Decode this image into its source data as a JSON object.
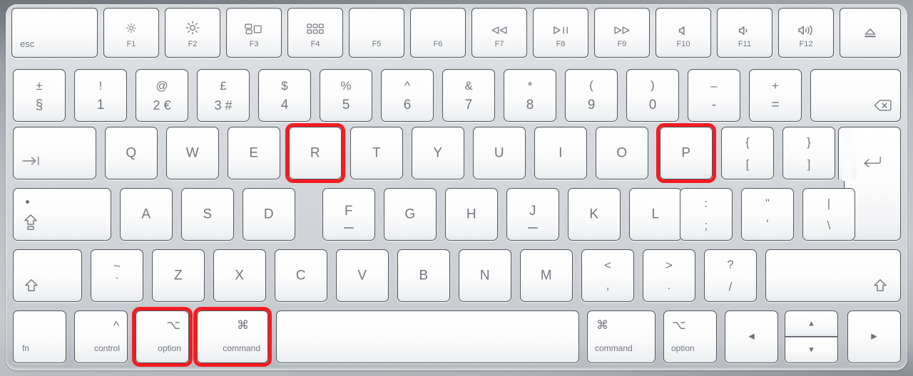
{
  "device": {
    "name": "apple-magic-keyboard",
    "layout": "British ISO",
    "body_color": "#d4d8dc",
    "highlight_color": "#f31c20"
  },
  "highlighted_keys": [
    "R",
    "P",
    "option",
    "command"
  ],
  "rows": {
    "function_row": [
      {
        "id": "esc",
        "label": "esc",
        "icon": null
      },
      {
        "id": "f1",
        "label": "F1",
        "icon": "brightness-down-icon"
      },
      {
        "id": "f2",
        "label": "F2",
        "icon": "brightness-up-icon"
      },
      {
        "id": "f3",
        "label": "F3",
        "icon": "mission-control-icon"
      },
      {
        "id": "f4",
        "label": "F4",
        "icon": "launchpad-icon"
      },
      {
        "id": "f5",
        "label": "F5",
        "icon": null
      },
      {
        "id": "f6",
        "label": "F6",
        "icon": null
      },
      {
        "id": "f7",
        "label": "F7",
        "icon": "rewind-icon"
      },
      {
        "id": "f8",
        "label": "F8",
        "icon": "play-pause-icon"
      },
      {
        "id": "f9",
        "label": "F9",
        "icon": "fast-forward-icon"
      },
      {
        "id": "f10",
        "label": "F10",
        "icon": "mute-icon"
      },
      {
        "id": "f11",
        "label": "F11",
        "icon": "volume-down-icon"
      },
      {
        "id": "f12",
        "label": "F12",
        "icon": "volume-up-icon"
      },
      {
        "id": "eject",
        "label": "",
        "icon": "eject-icon"
      }
    ],
    "number_row": [
      {
        "id": "section",
        "top": "±",
        "bottom": "§"
      },
      {
        "id": "1",
        "top": "!",
        "bottom": "1"
      },
      {
        "id": "2",
        "top": "@",
        "bottom": "2 €"
      },
      {
        "id": "3",
        "top": "£",
        "bottom": "3 #"
      },
      {
        "id": "4",
        "top": "$",
        "bottom": "4"
      },
      {
        "id": "5",
        "top": "%",
        "bottom": "5"
      },
      {
        "id": "6",
        "top": "^",
        "bottom": "6"
      },
      {
        "id": "7",
        "top": "&",
        "bottom": "7"
      },
      {
        "id": "8",
        "top": "*",
        "bottom": "8"
      },
      {
        "id": "9",
        "top": "(",
        "bottom": "9"
      },
      {
        "id": "0",
        "top": ")",
        "bottom": "0"
      },
      {
        "id": "minus",
        "top": "–",
        "bottom": "-"
      },
      {
        "id": "equals",
        "top": "+",
        "bottom": "="
      },
      {
        "id": "delete",
        "top": "",
        "bottom": "",
        "icon": "delete-backspace-icon"
      }
    ],
    "top_letter_row": [
      {
        "id": "tab",
        "label": "",
        "icon": "tab-icon"
      },
      {
        "id": "Q",
        "label": "Q"
      },
      {
        "id": "W",
        "label": "W"
      },
      {
        "id": "E",
        "label": "E"
      },
      {
        "id": "R",
        "label": "R",
        "highlighted": true
      },
      {
        "id": "T",
        "label": "T"
      },
      {
        "id": "Y",
        "label": "Y"
      },
      {
        "id": "U",
        "label": "U"
      },
      {
        "id": "I",
        "label": "I"
      },
      {
        "id": "O",
        "label": "O"
      },
      {
        "id": "P",
        "label": "P",
        "highlighted": true
      },
      {
        "id": "bracketleft",
        "top": "{",
        "bottom": "["
      },
      {
        "id": "bracketright",
        "top": "}",
        "bottom": "]"
      },
      {
        "id": "return",
        "label": "",
        "icon": "return-icon"
      }
    ],
    "home_row": [
      {
        "id": "capslock",
        "label": "",
        "icon": "caps-lock-icon"
      },
      {
        "id": "A",
        "label": "A"
      },
      {
        "id": "S",
        "label": "S"
      },
      {
        "id": "D",
        "label": "D"
      },
      {
        "id": "F",
        "label": "F",
        "home_bar": true
      },
      {
        "id": "G",
        "label": "G"
      },
      {
        "id": "H",
        "label": "H"
      },
      {
        "id": "J",
        "label": "J",
        "home_bar": true
      },
      {
        "id": "K",
        "label": "K"
      },
      {
        "id": "L",
        "label": "L"
      },
      {
        "id": "semicolon",
        "top": ":",
        "bottom": ";"
      },
      {
        "id": "quote",
        "top": "\"",
        "bottom": "'"
      },
      {
        "id": "backslash",
        "top": "|",
        "bottom": "\\"
      }
    ],
    "bottom_letter_row": [
      {
        "id": "shift-left",
        "label": "",
        "icon": "shift-icon"
      },
      {
        "id": "grave",
        "top": "~",
        "bottom": "`"
      },
      {
        "id": "Z",
        "label": "Z"
      },
      {
        "id": "X",
        "label": "X"
      },
      {
        "id": "C",
        "label": "C"
      },
      {
        "id": "V",
        "label": "V"
      },
      {
        "id": "B",
        "label": "B"
      },
      {
        "id": "N",
        "label": "N"
      },
      {
        "id": "M",
        "label": "M"
      },
      {
        "id": "comma",
        "top": "<",
        "bottom": ","
      },
      {
        "id": "period",
        "top": ">",
        "bottom": "."
      },
      {
        "id": "slash",
        "top": "?",
        "bottom": "/"
      },
      {
        "id": "shift-right",
        "label": "",
        "icon": "shift-icon"
      }
    ],
    "modifier_row": [
      {
        "id": "fn",
        "label": "fn",
        "symbol": null
      },
      {
        "id": "control",
        "label": "control",
        "symbol": "^"
      },
      {
        "id": "option-left",
        "label": "option",
        "symbol": "⌥",
        "highlighted": true
      },
      {
        "id": "command-left",
        "label": "command",
        "symbol": "⌘",
        "highlighted": true
      },
      {
        "id": "space",
        "label": "",
        "symbol": null
      },
      {
        "id": "command-right",
        "label": "command",
        "symbol": "⌘"
      },
      {
        "id": "option-right",
        "label": "option",
        "symbol": "⌥"
      },
      {
        "id": "arrow-left",
        "label": "",
        "symbol": "◀"
      },
      {
        "id": "arrow-up",
        "label": "",
        "symbol": "▲"
      },
      {
        "id": "arrow-down",
        "label": "",
        "symbol": "▼"
      },
      {
        "id": "arrow-right",
        "label": "",
        "symbol": "▶"
      }
    ]
  }
}
